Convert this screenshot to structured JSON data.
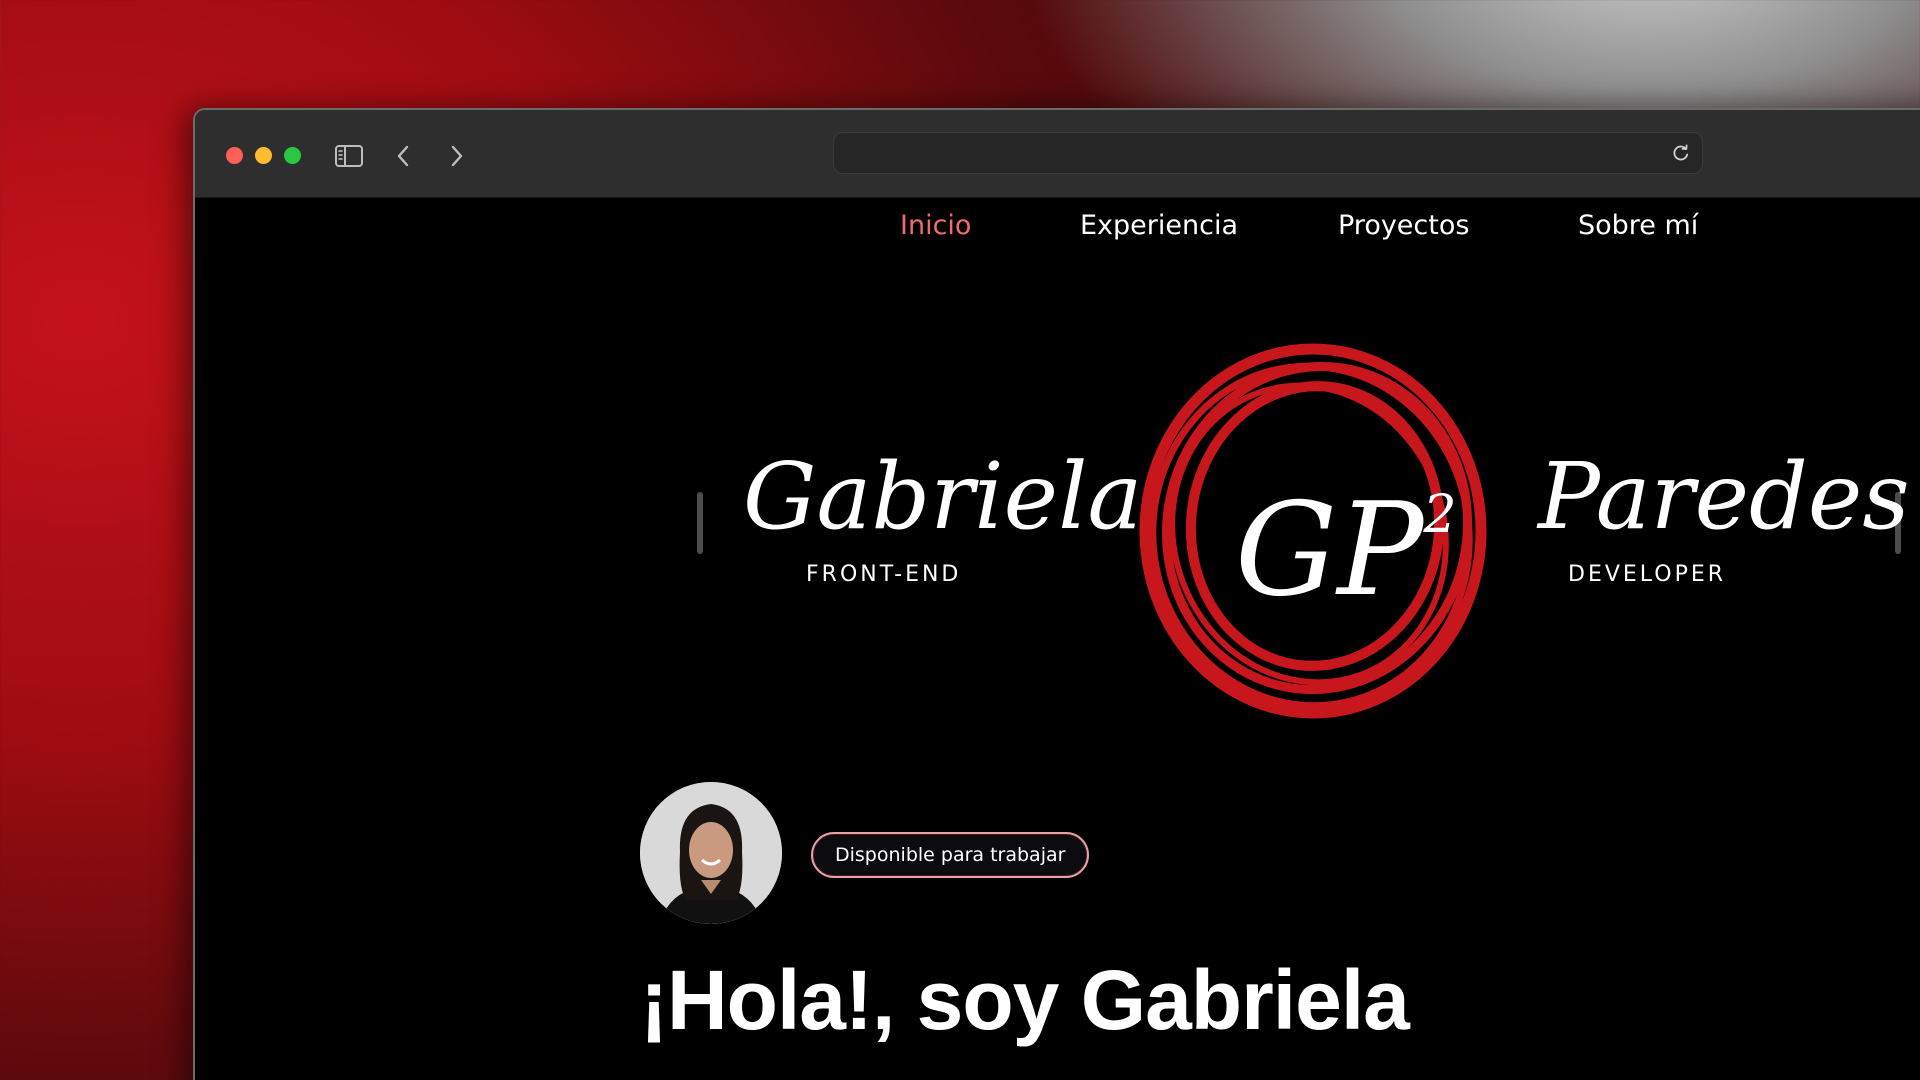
{
  "nav": {
    "items": [
      {
        "label": "Inicio",
        "active": true
      },
      {
        "label": "Experiencia",
        "active": false
      },
      {
        "label": "Proyectos",
        "active": false
      },
      {
        "label": "Sobre mí",
        "active": false
      }
    ]
  },
  "logo": {
    "first_name": "Gabriela",
    "first_sub": "FRONT-END",
    "monogram": "GP",
    "monogram_sup": "2",
    "last_name": "Paredes",
    "last_sub": "DEVELOPER"
  },
  "profile": {
    "badge_label": "Disponible para trabajar"
  },
  "hero": {
    "title": "¡Hola!, soy Gabriela"
  },
  "colors": {
    "accent": "#c8161d",
    "nav_active": "#f26b6b",
    "page_bg": "#000000",
    "toolbar_bg": "#2e2e2e"
  },
  "icons": {
    "sidebar_toggle": "sidebar-icon",
    "back": "chevron-left-icon",
    "forward": "chevron-right-icon",
    "reload": "reload-icon"
  }
}
